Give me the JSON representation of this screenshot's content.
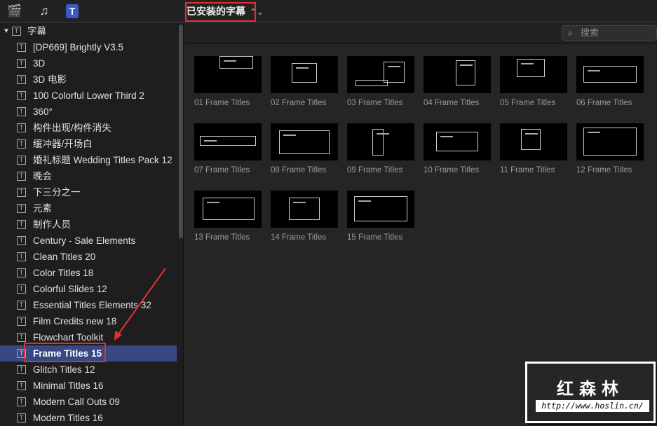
{
  "toolbar": {
    "icons": [
      "clapper-star-icon",
      "music-icon",
      "titles-icon"
    ],
    "filter_label": "已安装的字幕",
    "filter_chevron": "⌃⌄"
  },
  "search": {
    "placeholder": "搜索"
  },
  "sidebar": {
    "root": "字幕",
    "selected_index": 19,
    "items": [
      "[DP669] Brightly V3.5",
      "3D",
      "3D 电影",
      "100 Colorful Lower Third 2",
      "360°",
      "构件出现/构件消失",
      "缓冲器/开场白",
      "婚礼标题 Wedding Titles Pack 12",
      "晚会",
      "下三分之一",
      "元素",
      "制作人员",
      "Century - Sale Elements",
      "Clean Titles 20",
      "Color Titles 18",
      "Colorful Slides 12",
      "Essential Titles Elements 32",
      "Film Credits new 18",
      "Flowchart Toolkit",
      "Frame Titles 15",
      "Glitch Titles 12",
      "Minimal Titles 16",
      "Modern Call Outs 09",
      "Modern Titles 16"
    ]
  },
  "browser": {
    "tiles": [
      "01 Frame Titles",
      "02 Frame Titles",
      "03 Frame Titles",
      "04 Frame Titles",
      "05 Frame Titles",
      "06 Frame Titles",
      "07 Frame Titles",
      "08 Frame Titles",
      "09 Frame Titles",
      "10 Frame Titles",
      "11 Frame Titles",
      "12 Frame Titles",
      "13 Frame Titles",
      "14 Frame Titles",
      "15 Frame Titles"
    ]
  },
  "watermark": {
    "title": "红森林",
    "url": "http://www.hoslin.cn/"
  },
  "colors": {
    "selection": "#3a4785",
    "annotation": "#e03030"
  }
}
